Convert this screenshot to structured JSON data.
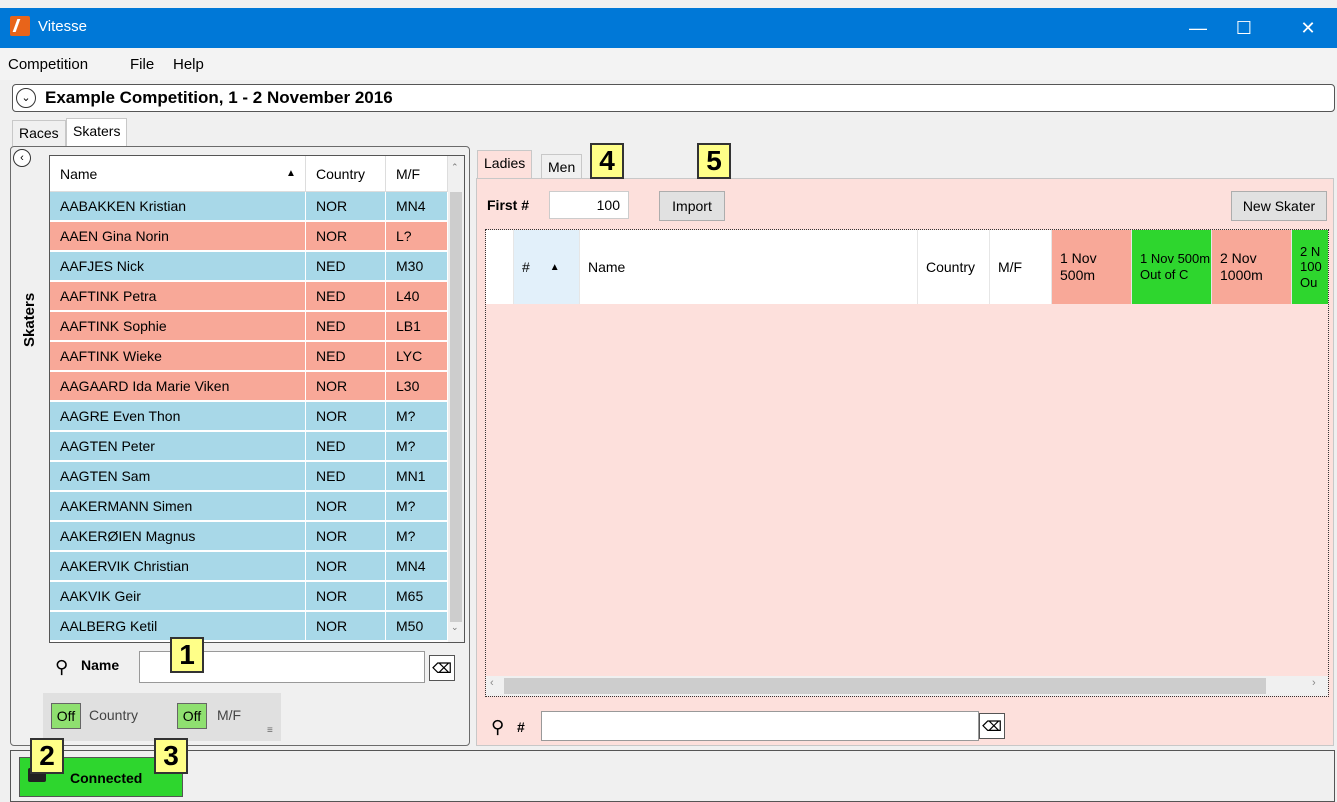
{
  "window": {
    "title": "Vitesse",
    "minimize": "—",
    "maximize": "☐",
    "close": "✕"
  },
  "menu": [
    "Competition",
    "File",
    "Help"
  ],
  "competition": {
    "title": "Example Competition, 1 - 2 November 2016"
  },
  "main_tabs": [
    "Races",
    "Skaters"
  ],
  "skaters_panel": {
    "vertical_label": "Skaters",
    "columns": [
      "Name",
      "Country",
      "M/F"
    ],
    "rows": [
      {
        "name": "AABAKKEN Kristian",
        "country": "NOR",
        "mf": "MN4",
        "gender": "M"
      },
      {
        "name": "AAEN Gina Norin",
        "country": "NOR",
        "mf": "L?",
        "gender": "L"
      },
      {
        "name": "AAFJES Nick",
        "country": "NED",
        "mf": "M30",
        "gender": "M"
      },
      {
        "name": "AAFTINK Petra",
        "country": "NED",
        "mf": "L40",
        "gender": "L"
      },
      {
        "name": "AAFTINK Sophie",
        "country": "NED",
        "mf": "LB1",
        "gender": "L"
      },
      {
        "name": "AAFTINK Wieke",
        "country": "NED",
        "mf": "LYC",
        "gender": "L"
      },
      {
        "name": "AAGAARD Ida Marie Viken",
        "country": "NOR",
        "mf": "L30",
        "gender": "L"
      },
      {
        "name": "AAGRE Even Thon",
        "country": "NOR",
        "mf": "M?",
        "gender": "M"
      },
      {
        "name": "AAGTEN Peter",
        "country": "NED",
        "mf": "M?",
        "gender": "M"
      },
      {
        "name": "AAGTEN Sam",
        "country": "NED",
        "mf": "MN1",
        "gender": "M"
      },
      {
        "name": "AAKERMANN Simen",
        "country": "NOR",
        "mf": "M?",
        "gender": "M"
      },
      {
        "name": "AAKERØIEN Magnus",
        "country": "NOR",
        "mf": "M?",
        "gender": "M"
      },
      {
        "name": "AAKERVIK Christian",
        "country": "NOR",
        "mf": "MN4",
        "gender": "M"
      },
      {
        "name": "AAKVIK Geir",
        "country": "NOR",
        "mf": "M65",
        "gender": "M"
      },
      {
        "name": "AALBERG Ketil",
        "country": "NOR",
        "mf": "M50",
        "gender": "M"
      }
    ],
    "search_label": "Name",
    "search_value": "",
    "filters": [
      {
        "state": "Off",
        "label": "Country"
      },
      {
        "state": "Off",
        "label": "M/F"
      }
    ]
  },
  "races_panel": {
    "tabs": [
      "Ladies",
      "Men"
    ],
    "first_label": "First #",
    "first_value": "100",
    "import_label": "Import",
    "new_skater_label": "New Skater",
    "columns": [
      {
        "label": "#",
        "bg": "#e2f0fa"
      },
      {
        "label": "Name",
        "bg": "#ffffff"
      },
      {
        "label": "Country",
        "bg": "#ffffff"
      },
      {
        "label": "M/F",
        "bg": "#ffffff"
      },
      {
        "label": "1 Nov 500m",
        "bg": "#f8a898"
      },
      {
        "label": "1 Nov 500m Out of C",
        "bg": "#2ed62e"
      },
      {
        "label": "2 Nov 1000m",
        "bg": "#f8a898"
      },
      {
        "label": "2 N 100 Ou",
        "bg": "#2ed62e"
      }
    ],
    "search_label": "#",
    "search_value": ""
  },
  "status": {
    "connected_label": "Connected"
  },
  "callouts": [
    "1",
    "2",
    "3",
    "4",
    "5"
  ],
  "colors": {
    "titlebar": "#0078d7",
    "male_row": "#a8d8e8",
    "female_row": "#f8a898",
    "ladies_bg": "#fde0dc",
    "connected": "#2ed62e",
    "callout": "#ffff88"
  }
}
